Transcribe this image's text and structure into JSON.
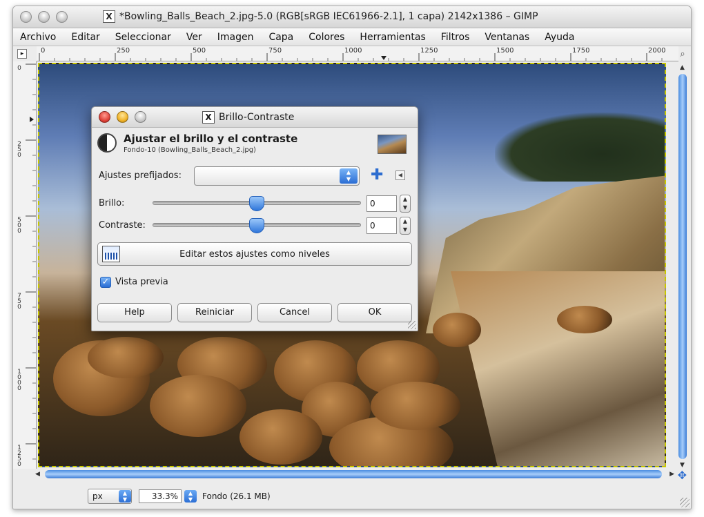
{
  "window": {
    "title_prefix_icon": "X",
    "title": "*Bowling_Balls_Beach_2.jpg-5.0 (RGB[sRGB IEC61966-2.1], 1 capa) 2142x1386 – GIMP"
  },
  "menubar": {
    "items": [
      "Archivo",
      "Editar",
      "Seleccionar",
      "Ver",
      "Imagen",
      "Capa",
      "Colores",
      "Herramientas",
      "Filtros",
      "Ventanas",
      "Ayuda"
    ]
  },
  "ruler": {
    "h_labels": [
      "0",
      "250",
      "500",
      "750",
      "1000",
      "1250",
      "1500",
      "1750",
      "2000"
    ],
    "v_labels": [
      "0",
      "250",
      "500",
      "750",
      "1000",
      "1250"
    ]
  },
  "statusbar": {
    "unit": "px",
    "zoom": "33.3%",
    "layer_info": "Fondo (26.1 MB)"
  },
  "dialog": {
    "title_icon": "X",
    "title": "Brillo-Contraste",
    "header_title": "Ajustar el brillo y el contraste",
    "header_subtitle": "Fondo-10 (Bowling_Balls_Beach_2.jpg)",
    "presets_label": "Ajustes prefijados:",
    "presets_value": "",
    "brightness_label": "Brillo:",
    "brightness_value": "0",
    "contrast_label": "Contraste:",
    "contrast_value": "0",
    "levels_button": "Editar estos ajustes como niveles",
    "preview_label": "Vista previa",
    "preview_checked": true,
    "buttons": {
      "help": "Help",
      "reset": "Reiniciar",
      "cancel": "Cancel",
      "ok": "OK"
    }
  },
  "colors": {
    "accent_blue": "#2a6dd4",
    "close_red": "#e0443a",
    "minimize_yellow": "#f0b32a",
    "selection_yellow": "#c8c800"
  }
}
